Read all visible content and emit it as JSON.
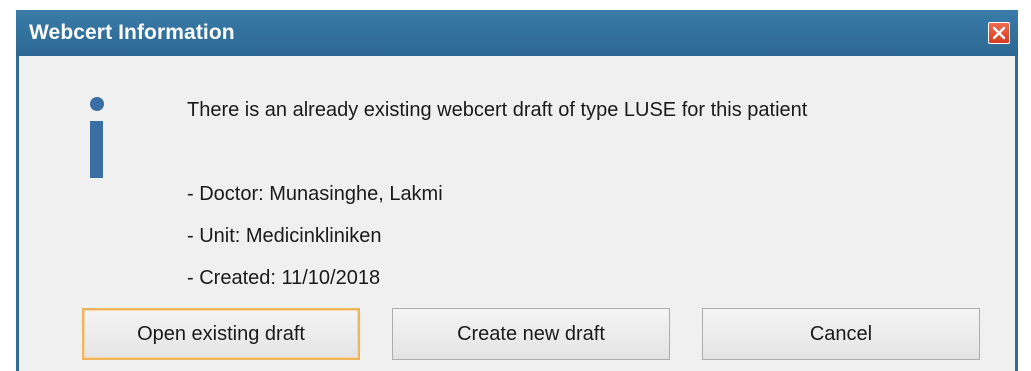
{
  "dialog": {
    "title": "Webcert Information",
    "close_icon": "close-icon",
    "message": "There is an already existing webcert draft of type LUSE for this patient",
    "details": [
      "- Doctor: Munasinghe, Lakmi",
      "- Unit: Medicinkliniken",
      "- Created: 11/10/2018"
    ],
    "icon": "info-icon"
  },
  "buttons": {
    "open_existing": "Open existing draft",
    "create_new": "Create new draft",
    "cancel": "Cancel"
  },
  "colors": {
    "titlebar": "#2f6d98",
    "content_bg": "#f0f0f0",
    "info_icon": "#3b6fa3",
    "close_button": "#e04a2c",
    "default_button_border": "#f0b45c"
  }
}
